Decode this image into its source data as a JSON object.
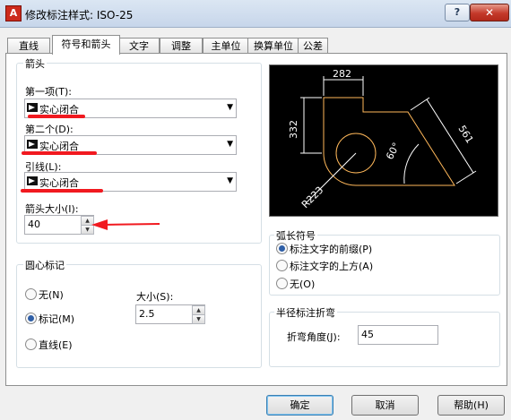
{
  "window": {
    "title": "修改标注样式: ISO-25",
    "help_glyph": "?",
    "close_glyph": "✕"
  },
  "tabs": [
    {
      "label": "直线"
    },
    {
      "label": "符号和箭头"
    },
    {
      "label": "文字"
    },
    {
      "label": "调整"
    },
    {
      "label": "主单位"
    },
    {
      "label": "换算单位"
    },
    {
      "label": "公差"
    }
  ],
  "arrowheads": {
    "group_title": "箭头",
    "first_label": "第一项(T):",
    "first_value": "实心闭合",
    "second_label": "第二个(D):",
    "second_value": "实心闭合",
    "leader_label": "引线(L):",
    "leader_value": "实心闭合",
    "size_label": "箭头大小(I):",
    "size_value": "40"
  },
  "center_marks": {
    "group_title": "圆心标记",
    "options": [
      "无(N)",
      "标记(M)",
      "直线(E)"
    ],
    "selected": "标记(M)",
    "size_label": "大小(S):",
    "size_value": "2.5"
  },
  "arc_length": {
    "group_title": "弧长符号",
    "options": [
      "标注文字的前缀(P)",
      "标注文字的上方(A)",
      "无(O)"
    ],
    "selected": "标注文字的前缀(P)"
  },
  "radius_jog": {
    "group_title": "半径标注折弯",
    "angle_label": "折弯角度(J):",
    "angle_value": "45"
  },
  "preview": {
    "dim_top": "282",
    "dim_left": "332",
    "dim_slant": "561",
    "dim_angle": "60°",
    "dim_radius": "R223"
  },
  "buttons": {
    "ok": "确定",
    "cancel": "取消",
    "help": "帮助(H)"
  },
  "colors": {
    "annotation_red": "#f1191f",
    "geometry": "#ffb85a",
    "dimension": "#ffffff"
  }
}
